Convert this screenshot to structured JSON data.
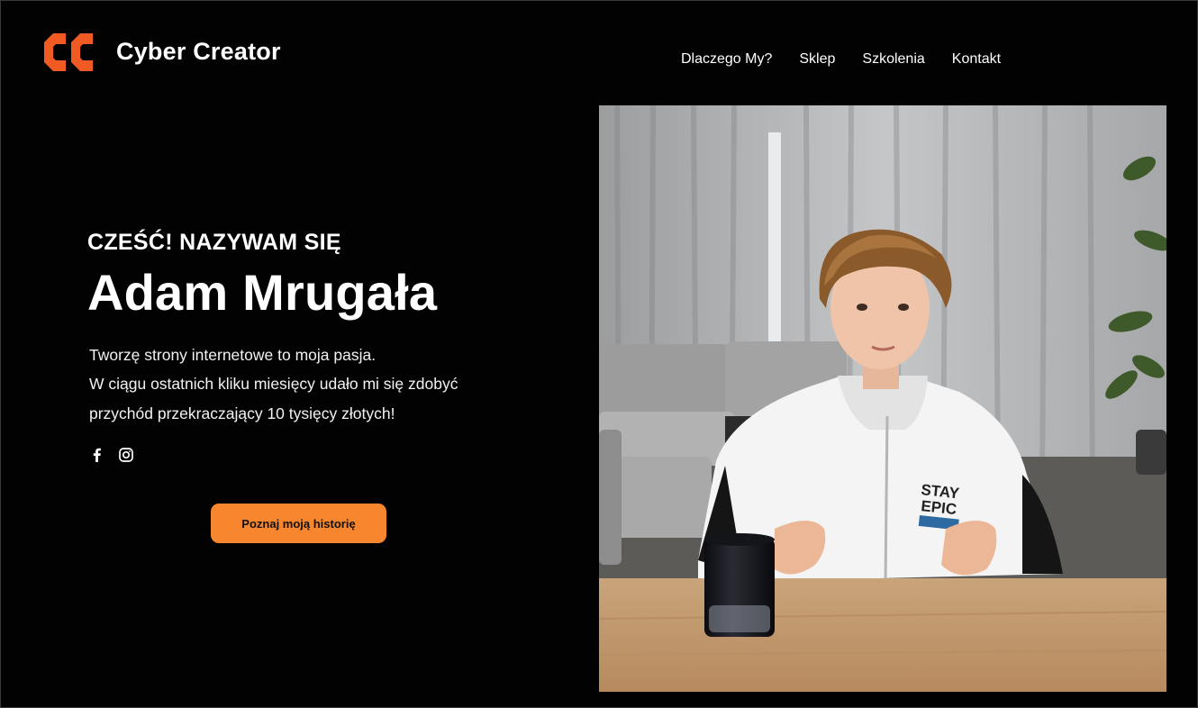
{
  "header": {
    "brand_name": "Cyber Creator",
    "logo_icon": "cc-logo-icon",
    "nav": [
      {
        "label": "Dlaczego My?"
      },
      {
        "label": "Sklep"
      },
      {
        "label": "Szkolenia"
      },
      {
        "label": "Kontakt"
      }
    ]
  },
  "hero": {
    "greeting": "CZEŚĆ! NAZYWAM SIĘ",
    "name": "Adam Mrugała",
    "description_lines": [
      "Tworzę strony internetowe to moja pasja.",
      "W ciągu ostatnich kliku miesięcy udało mi się zdobyć",
      "przychód przekraczający 10 tysięcy złotych!"
    ],
    "social": [
      {
        "icon": "facebook-icon"
      },
      {
        "icon": "instagram-icon"
      }
    ],
    "cta_label": "Poznaj moją historię",
    "photo_shirt_text": [
      "STAY",
      "EPIC"
    ]
  },
  "colors": {
    "accent": "#f7862e",
    "logo": "#f25a23",
    "background": "#020202"
  }
}
